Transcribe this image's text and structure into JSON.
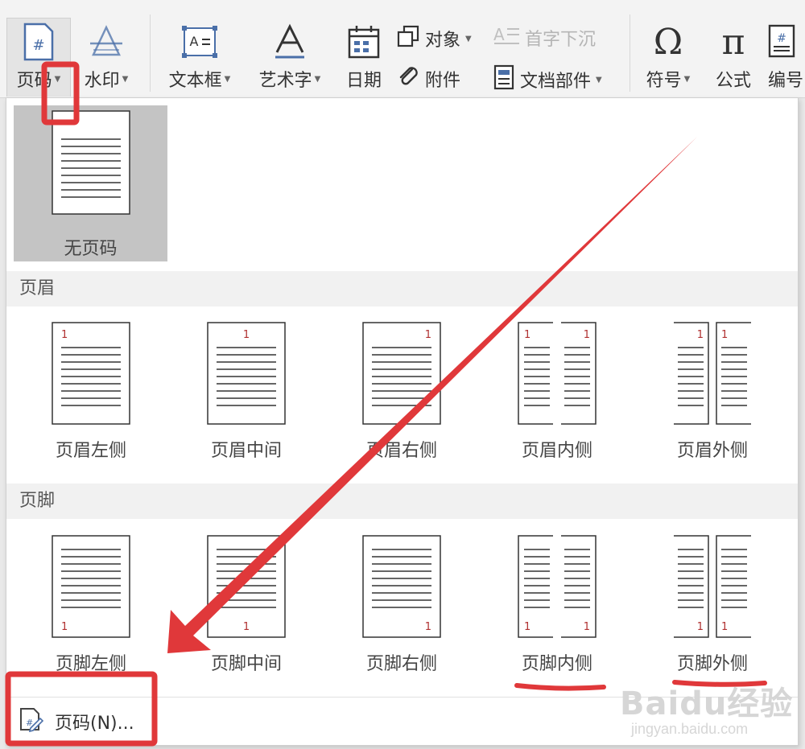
{
  "ribbon": {
    "page_number": "页码",
    "watermark": "水印",
    "text_box": "文本框",
    "word_art": "艺术字",
    "date": "日期",
    "object": "对象",
    "drop_cap": "首字下沉",
    "attachment": "附件",
    "doc_parts": "文档部件",
    "symbol": "符号",
    "formula": "公式",
    "numbering": "编号",
    "icons": {
      "page_number": "hash-page-icon",
      "watermark": "watermark-icon",
      "text_box": "text-box-icon",
      "word_art": "word-art-icon",
      "date": "calendar-icon",
      "object": "object-icon",
      "drop_cap": "drop-cap-icon",
      "attachment": "paperclip-icon",
      "doc_parts": "document-parts-icon",
      "symbol": "omega-icon",
      "formula": "pi-icon",
      "numbering": "hash-numbering-icon"
    }
  },
  "dropdown": {
    "none_label": "无页码",
    "header_section": "页眉",
    "header_options": [
      "页眉左侧",
      "页眉中间",
      "页眉右侧",
      "页眉内侧",
      "页眉外侧"
    ],
    "footer_section": "页脚",
    "footer_options": [
      "页脚左侧",
      "页脚中间",
      "页脚右侧",
      "页脚内侧",
      "页脚外侧"
    ],
    "page_number_marker": "1",
    "page_number_command": "页码(N)..."
  },
  "watermark": {
    "brand": "Baidu经验",
    "url": "jingyan.baidu.com"
  },
  "colors": {
    "annotation_red": "#e0383a",
    "selected_bg": "#c4c4c4",
    "page_marker": "#b03030"
  }
}
